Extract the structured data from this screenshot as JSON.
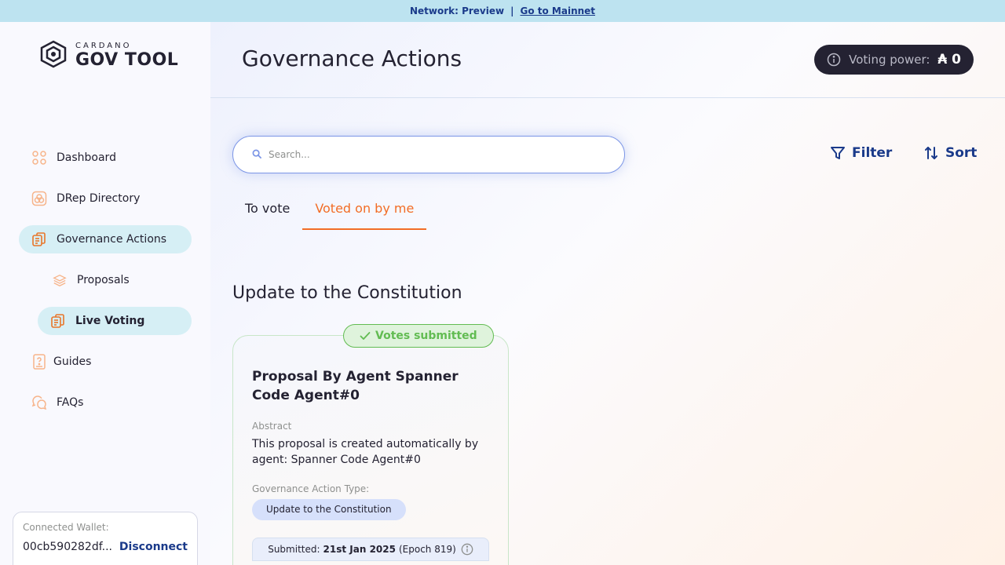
{
  "banner": {
    "network": "Network: Preview",
    "separator": "|",
    "link": "Go to Mainnet"
  },
  "logo": {
    "small": "CARDANO",
    "big": "GOV TOOL"
  },
  "sidebar": {
    "items": [
      {
        "label": "Dashboard",
        "icon": "dashboard-icon"
      },
      {
        "label": "DRep Directory",
        "icon": "drep-icon"
      },
      {
        "label": "Governance Actions",
        "icon": "governance-icon",
        "active": true
      },
      {
        "label": "Proposals",
        "icon": "layers-icon"
      },
      {
        "label": "Live Voting",
        "icon": "governance-icon",
        "active": true
      },
      {
        "label": "Guides",
        "icon": "guide-icon"
      },
      {
        "label": "FAQs",
        "icon": "faq-icon"
      }
    ]
  },
  "wallet": {
    "label": "Connected Wallet:",
    "address": "00cb590282df...",
    "disconnect": "Disconnect"
  },
  "header": {
    "title": "Governance Actions",
    "voting_power_label": "Voting power:",
    "voting_power_value": "₳ 0"
  },
  "search": {
    "placeholder": "Search..."
  },
  "toolbar": {
    "filter": "Filter",
    "sort": "Sort"
  },
  "tabs": [
    {
      "label": "To vote"
    },
    {
      "label": "Voted on by me",
      "active": true
    }
  ],
  "section": {
    "title": "Update to the Constitution"
  },
  "card": {
    "badge": "Votes submitted",
    "title": "Proposal By Agent Spanner Code Agent#0",
    "abstract_label": "Abstract",
    "abstract": "This proposal is created automatically by agent: Spanner Code Agent#0",
    "type_label": "Governance Action Type:",
    "type": "Update to the Constitution",
    "submitted_label": "Submitted:",
    "submitted_date": "21st Jan 2025",
    "submitted_epoch": "(Epoch 819)"
  },
  "colors": {
    "accent": "#f26d26",
    "primary": "#1a3a8a",
    "success": "#62bc52",
    "banner": "#bde3f0"
  }
}
